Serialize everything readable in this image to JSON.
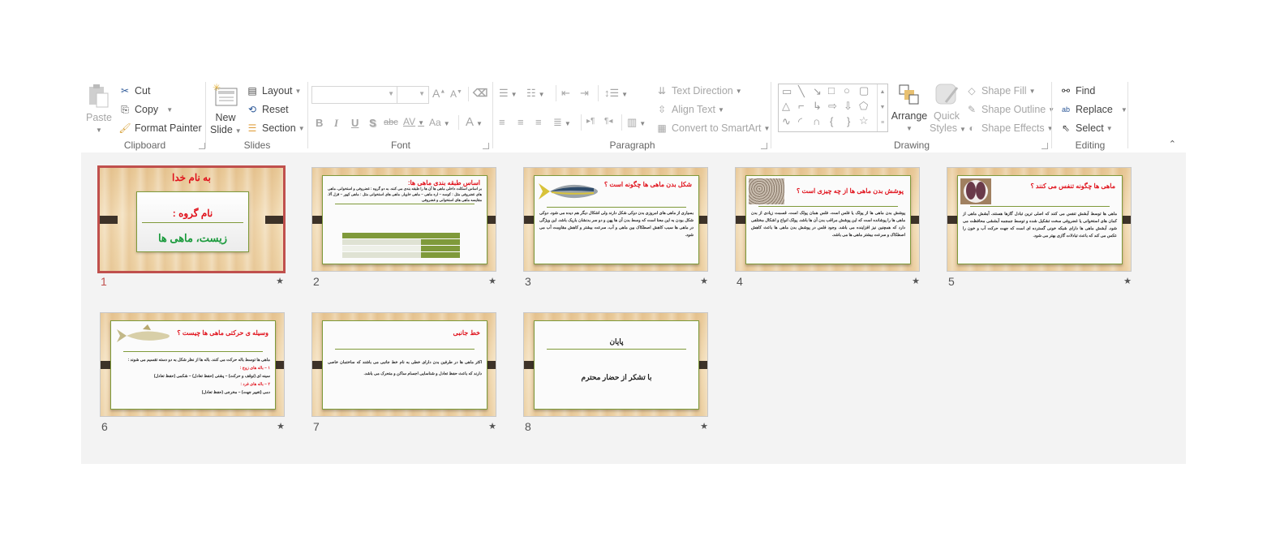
{
  "ribbon": {
    "clipboard": {
      "label": "Clipboard",
      "paste": "Paste",
      "cut": "Cut",
      "copy": "Copy",
      "format_painter": "Format Painter"
    },
    "slides": {
      "label": "Slides",
      "new_slide_line1": "New",
      "new_slide_line2": "Slide",
      "layout": "Layout",
      "reset": "Reset",
      "section": "Section"
    },
    "font": {
      "label": "Font",
      "font_name_value": "",
      "font_size_value": "",
      "bold": "B",
      "italic": "I",
      "underline": "U",
      "shadow": "S",
      "strikethrough": "abc",
      "char_spacing": "AV",
      "change_case": "Aa",
      "font_color": "A",
      "grow": "A",
      "shrink": "A"
    },
    "paragraph": {
      "label": "Paragraph",
      "text_direction": "Text Direction",
      "align_text": "Align Text",
      "convert_smartart": "Convert to SmartArt"
    },
    "drawing": {
      "label": "Drawing",
      "arrange": "Arrange",
      "quick_styles_line1": "Quick",
      "quick_styles_line2": "Styles",
      "shape_fill": "Shape Fill",
      "shape_outline": "Shape Outline",
      "shape_effects": "Shape Effects"
    },
    "editing": {
      "label": "Editing",
      "find": "Find",
      "replace": "Replace",
      "select": "Select"
    }
  },
  "slides": [
    {
      "number": "1",
      "selected": true,
      "header": "به نام خدا",
      "group_label": "نام گروه :",
      "group_name": "زیست، ماهی ها"
    },
    {
      "number": "2",
      "title": "اساس طبقه بندی ماهی ها:",
      "body": "بر اساس اسکلت داخلی ماهی ها آن ها را طبقه بندی می کنند. به دو گروه : غضروفی و استخوانی. ماهی های غضروفی مثل : کوسه – اره ماهی – ماهی خاویار. ماهی های استخوانی مثل : ماهی کپور – قزل آلا. مقایسه ماهی های استخوانی و غضروفی"
    },
    {
      "number": "3",
      "title": "شکل بدن ماهی ها چگونه است ؟",
      "body": "بسیاری از ماهی های امروزی بدن دوکی شکل دارند ولی اشکال دیگر هم دیده می شود. دوکی شکل بودن به این معنا است که وسط بدن آن ها پهن و دو سر بدنشان باریک باشد. این ویژگی در ماهی ها سبب کاهش اصطکاک بین ماهی و آب، سرعت بیشتر و کاهش مقاومت آب می شود."
    },
    {
      "number": "4",
      "title": "پوشش بدن ماهی ها از چه چیزی است ؟",
      "body": "پوشش بدن ماهی ها از پولک یا فلس است. فلس همان پولک است. قسمت زیادی از بدن ماهی ها را پوشانده است که این پوشش مراقب بدن آن ها باشد. پولک انواع و اشکال مختلفی دارد که همچنین نیز افزاینده می باشد. وجود فلس در پوشش بدن ماهی ها باعث کاهش اصطکاک و سرعت بیشتر ماهی ها می باشد."
    },
    {
      "number": "5",
      "title": "ماهی ها چگونه تنفس می کنند ؟",
      "body": "ماهی ها توسط آبشش تنفس می کنند که اصلی ترین تبادل گازها هستند. آبشش ماهی از کمان های استخوانی یا غضروفی سخت تشکیل شده و توسط جمجمه آبششی محافظت می شود. آبشش ماهی ها دارای شبکه خونی گسترده ای است که جهت حرکت آب و خون را عکس می کند که باعث تبادلات گازی بهتر می شود."
    },
    {
      "number": "6",
      "title": "وسیله ی حرکتی ماهی ها چیست ؟",
      "body_lines": [
        {
          "text": "ماهی ها توسط باله حرکت می کنند. باله ها از نظر شکل به دو دسته تقسیم می شوند :",
          "red": false
        },
        {
          "text": "۱ – باله های زوج :",
          "red": true
        },
        {
          "text": "سینه ای (توقف و حرکت) – پشتی (حفظ تعادل) – شکمی (حفظ تعادل)",
          "red": false
        },
        {
          "text": "۲ – باله های فرد :",
          "red": true
        },
        {
          "text": "دمی (تغییر جهت) – مخرجی (حفظ تعادل)",
          "red": false
        }
      ]
    },
    {
      "number": "7",
      "title": "خط جانبی",
      "body": "اکثر ماهی ها در طرفین بدن دارای خطی به نام خط جانبی می باشند که ساختمان خاصی دارند که باعث حفظ تعادل و شناسایی اجسام ساکن و متحرک می باشد."
    },
    {
      "number": "8",
      "title": "پایان",
      "subtitle": "با تشکر از حضار محترم"
    }
  ],
  "slide_star": "★",
  "colors": {
    "selection": "#c0504d",
    "title_red": "#e0111b",
    "title_green": "#1a9a3c",
    "rule_green": "#7f9a3a",
    "table_green": "#7f9a3a"
  },
  "slide2_table": {
    "rows": [
      [
        "",
        "",
        ""
      ],
      [
        "",
        "",
        ""
      ],
      [
        "",
        "",
        ""
      ],
      [
        "",
        "",
        ""
      ]
    ]
  }
}
